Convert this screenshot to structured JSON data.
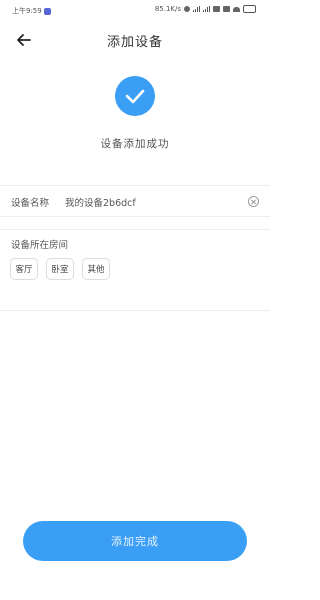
{
  "status_bar": {
    "time": "上午9:59",
    "speed": "85.1K/s"
  },
  "header": {
    "title": "添加设备"
  },
  "result": {
    "message": "设备添加成功"
  },
  "device_name": {
    "label": "设备名称",
    "value": "我的设备2b6dcf"
  },
  "room": {
    "label": "设备所在房间",
    "options": [
      "客厅",
      "卧室",
      "其他"
    ]
  },
  "footer": {
    "done_label": "添加完成"
  },
  "colors": {
    "accent": "#3a9ef4"
  }
}
